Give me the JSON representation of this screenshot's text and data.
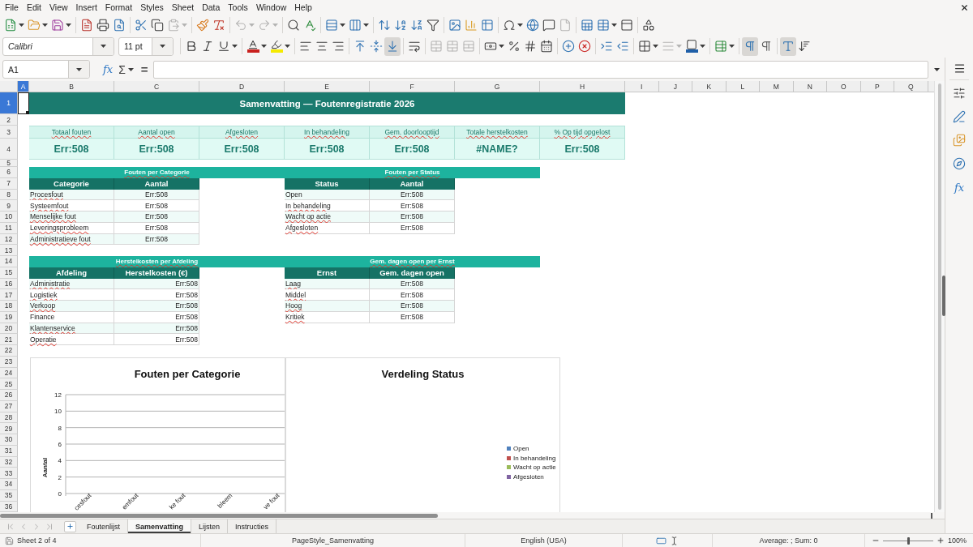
{
  "menu_bar": {
    "items": [
      "File",
      "Edit",
      "View",
      "Insert",
      "Format",
      "Styles",
      "Sheet",
      "Data",
      "Tools",
      "Window",
      "Help"
    ]
  },
  "standard_toolbar": {
    "groups": [
      {
        "buttons": [
          {
            "kind": "new",
            "dropdown": true,
            "disabled": false
          },
          {
            "kind": "open",
            "dropdown": true,
            "disabled": false
          },
          {
            "kind": "save",
            "dropdown": true,
            "disabled": false
          }
        ]
      },
      {
        "buttons": [
          {
            "kind": "export_pdf",
            "dropdown": false,
            "disabled": false
          },
          {
            "kind": "print",
            "dropdown": false,
            "disabled": false
          },
          {
            "kind": "print_preview",
            "dropdown": false,
            "disabled": false
          }
        ]
      },
      {
        "buttons": [
          {
            "kind": "cut",
            "dropdown": false,
            "disabled": false
          },
          {
            "kind": "copy",
            "dropdown": false,
            "disabled": false
          },
          {
            "kind": "paste",
            "dropdown": true,
            "disabled": true
          }
        ]
      },
      {
        "buttons": [
          {
            "kind": "clone_formatting",
            "dropdown": false,
            "disabled": false
          },
          {
            "kind": "clear_formatting",
            "dropdown": false,
            "disabled": false
          }
        ]
      },
      {
        "buttons": [
          {
            "kind": "undo",
            "dropdown": true,
            "disabled": true
          },
          {
            "kind": "redo",
            "dropdown": true,
            "disabled": true
          }
        ]
      },
      {
        "buttons": [
          {
            "kind": "find_replace",
            "dropdown": false,
            "disabled": false
          },
          {
            "kind": "spelling",
            "dropdown": false,
            "disabled": false
          }
        ]
      },
      {
        "buttons": [
          {
            "kind": "rows",
            "dropdown": true,
            "disabled": false
          },
          {
            "kind": "columns",
            "dropdown": true,
            "disabled": false
          }
        ]
      },
      {
        "buttons": [
          {
            "kind": "sort",
            "dropdown": false,
            "disabled": false
          },
          {
            "kind": "sort_ascending",
            "dropdown": false,
            "disabled": false
          },
          {
            "kind": "sort_descending",
            "dropdown": false,
            "disabled": false
          },
          {
            "kind": "autofilter",
            "dropdown": false,
            "disabled": false
          }
        ]
      },
      {
        "buttons": [
          {
            "kind": "image",
            "dropdown": false,
            "disabled": false
          },
          {
            "kind": "chart",
            "dropdown": false,
            "disabled": false
          },
          {
            "kind": "pivot_table",
            "dropdown": false,
            "disabled": false
          }
        ]
      },
      {
        "buttons": [
          {
            "kind": "special_character",
            "dropdown": true,
            "disabled": false
          },
          {
            "kind": "hyperlink",
            "dropdown": false,
            "disabled": false
          },
          {
            "kind": "comment",
            "dropdown": false,
            "disabled": false
          },
          {
            "kind": "header_footer",
            "dropdown": false,
            "disabled": true
          }
        ]
      },
      {
        "buttons": [
          {
            "kind": "print_area",
            "dropdown": false,
            "disabled": false
          },
          {
            "kind": "freeze",
            "dropdown": true,
            "disabled": false
          },
          {
            "kind": "split_window",
            "dropdown": false,
            "disabled": false
          }
        ]
      },
      {
        "buttons": [
          {
            "kind": "draw_functions",
            "dropdown": false,
            "disabled": false
          }
        ]
      }
    ]
  },
  "formatting_toolbar": {
    "font_name": "Calibri",
    "font_size": "11 pt",
    "groups": [
      {
        "buttons": [
          {
            "kind": "bold",
            "dropdown": false,
            "disabled": false,
            "active": false
          },
          {
            "kind": "italic",
            "dropdown": false,
            "disabled": false,
            "active": false
          },
          {
            "kind": "underline",
            "dropdown": true,
            "disabled": false,
            "active": false
          }
        ]
      },
      {
        "buttons": [
          {
            "kind": "font_color",
            "dropdown": true,
            "disabled": false,
            "active": false
          },
          {
            "kind": "highlight",
            "dropdown": true,
            "disabled": false,
            "active": false
          }
        ]
      },
      {
        "buttons": [
          {
            "kind": "align_left",
            "dropdown": false,
            "disabled": false,
            "active": false
          },
          {
            "kind": "align_center",
            "dropdown": false,
            "disabled": false,
            "active": false
          },
          {
            "kind": "align_right",
            "dropdown": false,
            "disabled": false,
            "active": false
          }
        ]
      },
      {
        "buttons": [
          {
            "kind": "align_top",
            "dropdown": false,
            "disabled": false,
            "active": false
          },
          {
            "kind": "align_middle",
            "dropdown": false,
            "disabled": false,
            "active": false
          },
          {
            "kind": "align_bottom",
            "dropdown": false,
            "disabled": false,
            "active": true
          }
        ]
      },
      {
        "buttons": [
          {
            "kind": "wrap_text",
            "dropdown": false,
            "disabled": false,
            "active": false
          }
        ]
      },
      {
        "buttons": [
          {
            "kind": "merge_center",
            "dropdown": false,
            "disabled": true,
            "active": false
          },
          {
            "kind": "merge",
            "dropdown": false,
            "disabled": true,
            "active": false
          },
          {
            "kind": "unmerge",
            "dropdown": false,
            "disabled": true,
            "active": false
          }
        ]
      },
      {
        "buttons": [
          {
            "kind": "currency",
            "dropdown": true,
            "disabled": false,
            "active": false
          },
          {
            "kind": "percent",
            "dropdown": false,
            "disabled": false,
            "active": false
          },
          {
            "kind": "number",
            "dropdown": false,
            "disabled": false,
            "active": false
          },
          {
            "kind": "date",
            "dropdown": false,
            "disabled": false,
            "active": false
          }
        ]
      },
      {
        "buttons": [
          {
            "kind": "add_decimal",
            "dropdown": false,
            "disabled": false,
            "active": false
          },
          {
            "kind": "delete_decimal",
            "dropdown": false,
            "disabled": false,
            "active": false
          }
        ]
      },
      {
        "buttons": [
          {
            "kind": "indent_increase",
            "dropdown": false,
            "disabled": false,
            "active": false
          },
          {
            "kind": "indent_decrease",
            "dropdown": false,
            "disabled": false,
            "active": false
          }
        ]
      },
      {
        "buttons": [
          {
            "kind": "borders",
            "dropdown": true,
            "disabled": false,
            "active": false
          },
          {
            "kind": "border_style",
            "dropdown": true,
            "disabled": true,
            "active": false
          },
          {
            "kind": "border_color",
            "dropdown": true,
            "disabled": false,
            "active": false
          }
        ]
      },
      {
        "buttons": [
          {
            "kind": "conditional",
            "dropdown": true,
            "disabled": false,
            "active": false
          }
        ]
      },
      {
        "buttons": [
          {
            "kind": "ltr",
            "dropdown": false,
            "disabled": false,
            "active": true
          },
          {
            "kind": "rtl",
            "dropdown": false,
            "disabled": false,
            "active": false
          }
        ]
      },
      {
        "buttons": [
          {
            "kind": "horizontal_text",
            "dropdown": false,
            "disabled": false,
            "active": true
          },
          {
            "kind": "vertical_text",
            "dropdown": false,
            "disabled": false,
            "active": false
          }
        ]
      }
    ]
  },
  "formula_bar": {
    "name_box": "A1",
    "function_wizard": "fx",
    "sum": "Σ",
    "equals": "="
  },
  "sidebar": {
    "functions_label": "fx"
  },
  "sheet": {
    "columns": [
      {
        "label": "A",
        "selected": true
      },
      {
        "label": "B",
        "selected": false
      },
      {
        "label": "C",
        "selected": false
      },
      {
        "label": "D",
        "selected": false
      },
      {
        "label": "E",
        "selected": false
      },
      {
        "label": "F",
        "selected": false
      },
      {
        "label": "G",
        "selected": false
      },
      {
        "label": "H",
        "selected": false
      },
      {
        "label": "I",
        "selected": false
      },
      {
        "label": "J",
        "selected": false
      },
      {
        "label": "K",
        "selected": false
      },
      {
        "label": "L",
        "selected": false
      },
      {
        "label": "M",
        "selected": false
      },
      {
        "label": "N",
        "selected": false
      },
      {
        "label": "O",
        "selected": false
      },
      {
        "label": "P",
        "selected": false
      },
      {
        "label": "Q",
        "selected": false
      }
    ],
    "rows": [
      {
        "label": "1",
        "selected": true
      },
      {
        "label": "2",
        "selected": false
      },
      {
        "label": "3",
        "selected": false
      },
      {
        "label": "4",
        "selected": false
      },
      {
        "label": "5",
        "selected": false
      },
      {
        "label": "6",
        "selected": false
      },
      {
        "label": "7",
        "selected": false
      },
      {
        "label": "8",
        "selected": false
      },
      {
        "label": "9",
        "selected": false
      },
      {
        "label": "10",
        "selected": false
      },
      {
        "label": "11",
        "selected": false
      },
      {
        "label": "12",
        "selected": false
      },
      {
        "label": "13",
        "selected": false
      },
      {
        "label": "14",
        "selected": false
      },
      {
        "label": "15",
        "selected": false
      },
      {
        "label": "16",
        "selected": false
      },
      {
        "label": "17",
        "selected": false
      },
      {
        "label": "18",
        "selected": false
      },
      {
        "label": "19",
        "selected": false
      },
      {
        "label": "20",
        "selected": false
      },
      {
        "label": "21",
        "selected": false
      },
      {
        "label": "22",
        "selected": false
      },
      {
        "label": "23",
        "selected": false
      },
      {
        "label": "24",
        "selected": false
      },
      {
        "label": "25",
        "selected": false
      },
      {
        "label": "26",
        "selected": false
      },
      {
        "label": "27",
        "selected": false
      },
      {
        "label": "28",
        "selected": false
      },
      {
        "label": "29",
        "selected": false
      },
      {
        "label": "30",
        "selected": false
      },
      {
        "label": "31",
        "selected": false
      },
      {
        "label": "32",
        "selected": false
      },
      {
        "label": "33",
        "selected": false
      },
      {
        "label": "34",
        "selected": false
      },
      {
        "label": "35",
        "selected": false
      },
      {
        "label": "36",
        "selected": false
      }
    ],
    "title": "Samenvatting — Foutenregistratie 2026",
    "kpis": [
      {
        "label": "Totaal fouten",
        "misspelled": true,
        "value": "Err:508"
      },
      {
        "label": "Aantal open",
        "misspelled": true,
        "value": "Err:508"
      },
      {
        "label": "Afgesloten",
        "misspelled": true,
        "value": "Err:508"
      },
      {
        "label": "In behandeling",
        "misspelled": true,
        "value": "Err:508"
      },
      {
        "label": "Gem. doorlooptijd",
        "misspelled": true,
        "value": "Err:508"
      },
      {
        "label": "Totale herstelkosten",
        "misspelled": true,
        "value": "#NAME?"
      },
      {
        "label": "% Op tijd opgelost",
        "misspelled": true,
        "value": "Err:508"
      }
    ],
    "tables": [
      {
        "title": "Fouten per Categorie",
        "title_misspelled": true,
        "kind": "count",
        "headers": [
          "Categorie",
          "Aantal"
        ],
        "rows": [
          {
            "label": "Procesfout",
            "misspelled": true,
            "value": "Err:508"
          },
          {
            "label": "Systeemfout",
            "misspelled": true,
            "value": "Err:508"
          },
          {
            "label": "Menselijke fout",
            "misspelled": true,
            "value": "Err:508"
          },
          {
            "label": "Leveringsprobleem",
            "misspelled": true,
            "value": "Err:508"
          },
          {
            "label": "Administratieve fout",
            "misspelled": true,
            "value": "Err:508"
          }
        ]
      },
      {
        "title": "Fouten per Status",
        "title_misspelled": true,
        "kind": "count",
        "headers": [
          "Status",
          "Aantal"
        ],
        "rows": [
          {
            "label": "Open",
            "misspelled": false,
            "value": "Err:508"
          },
          {
            "label": "In behandeling",
            "misspelled": true,
            "value": "Err:508"
          },
          {
            "label": "Wacht op actie",
            "misspelled": true,
            "value": "Err:508"
          },
          {
            "label": "Afgesloten",
            "misspelled": true,
            "value": "Err:508"
          }
        ]
      },
      {
        "title": "Herstelkosten per Afdeling",
        "title_misspelled": true,
        "kind": "currency",
        "headers": [
          "Afdeling",
          "Herstelkosten (€)"
        ],
        "rows": [
          {
            "label": "Administratie",
            "misspelled": true,
            "value": "Err:508"
          },
          {
            "label": "Logistiek",
            "misspelled": true,
            "value": "Err:508"
          },
          {
            "label": "Verkoop",
            "misspelled": true,
            "value": "Err:508"
          },
          {
            "label": "Finance",
            "misspelled": false,
            "value": "Err:508"
          },
          {
            "label": "Klantenservice",
            "misspelled": true,
            "value": "Err:508"
          },
          {
            "label": "Operatie",
            "misspelled": true,
            "value": "Err:508"
          }
        ]
      },
      {
        "title": "Gem. dagen open per Ernst",
        "title_misspelled": true,
        "kind": "count",
        "headers": [
          "Ernst",
          "Gem. dagen open"
        ],
        "rows": [
          {
            "label": "Laag",
            "misspelled": true,
            "value": "Err:508"
          },
          {
            "label": "Middel",
            "misspelled": true,
            "value": "Err:508"
          },
          {
            "label": "Hoog",
            "misspelled": true,
            "value": "Err:508"
          },
          {
            "label": "Kritiek",
            "misspelled": true,
            "value": "Err:508"
          }
        ]
      }
    ],
    "charts": [
      {
        "chart_data": {
          "type": "bar",
          "title": "Fouten per Categorie",
          "ylabel": "Aantal",
          "categories": [
            "cesfout",
            "emfout",
            "ke fout",
            "bleem",
            "ve fout"
          ],
          "ylim": [
            0,
            12
          ],
          "yticks": [
            0,
            2,
            4,
            6,
            8,
            10,
            12
          ],
          "grid": true
        }
      },
      {
        "chart_data": {
          "type": "pie",
          "title": "Verdeling Status"
        },
        "legend": [
          {
            "label": "Open",
            "color": "#4f81bd"
          },
          {
            "label": "In behandeling",
            "color": "#c0504d"
          },
          {
            "label": "Wacht op actie",
            "color": "#9bbb59"
          },
          {
            "label": "Afgesloten",
            "color": "#8064a2"
          }
        ]
      }
    ]
  },
  "sheet_tabs": {
    "navigation": [
      {
        "kind": "first",
        "disabled": true
      },
      {
        "kind": "previous",
        "disabled": true
      },
      {
        "kind": "next",
        "disabled": true
      },
      {
        "kind": "last",
        "disabled": true
      }
    ],
    "tabs": [
      {
        "label": "Foutenlijst",
        "selected": false
      },
      {
        "label": "Samenvatting",
        "selected": true
      },
      {
        "label": "Lijsten",
        "selected": false
      },
      {
        "label": "Instructies",
        "selected": false
      }
    ]
  },
  "status_bar": {
    "sheet_info": "Sheet 2 of 4",
    "page_style": "PageStyle_Samenvatting",
    "language": "English (USA)",
    "selection_summary": "Average: ; Sum: 0",
    "zoom_slider": {
      "level": 0.5
    },
    "zoom": "100%"
  }
}
